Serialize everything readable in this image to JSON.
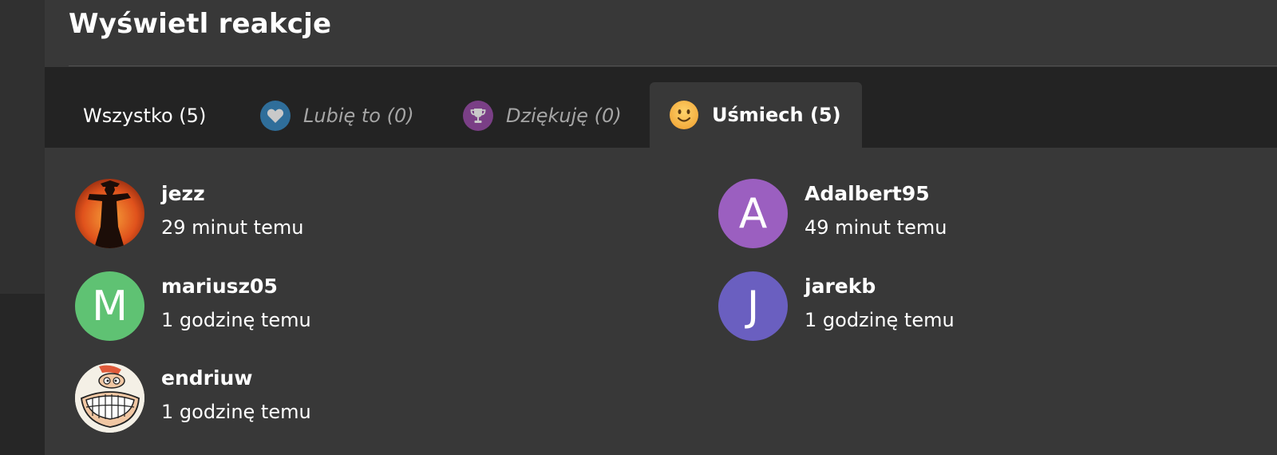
{
  "dialog": {
    "title": "Wyświetl reakcje"
  },
  "tabs": [
    {
      "label": "Wszystko (5)",
      "icon": null,
      "active": false
    },
    {
      "label": "Lubię to (0)",
      "icon": "heart-icon",
      "color": "#2f6e9a",
      "active": false
    },
    {
      "label": "Dziękuję (0)",
      "icon": "trophy-icon",
      "color": "#7a3f86",
      "active": false
    },
    {
      "label": "Uśmiech (5)",
      "icon": "smiley-icon",
      "color": "#f5b942",
      "active": true
    }
  ],
  "reactions": [
    {
      "name": "jezz",
      "time": "29 minut temu",
      "avatar_type": "image",
      "avatar_desc": "orange-scarecrow-silhouette"
    },
    {
      "name": "Adalbert95",
      "time": "49 minut temu",
      "avatar_type": "letter",
      "avatar_letter": "A",
      "avatar_color": "#9b5fc0"
    },
    {
      "name": "mariusz05",
      "time": "1 godzinę temu",
      "avatar_type": "letter",
      "avatar_letter": "M",
      "avatar_color": "#5fc273"
    },
    {
      "name": "jarekb",
      "time": "1 godzinę temu",
      "avatar_type": "letter",
      "avatar_letter": "J",
      "avatar_color": "#6a5fc0"
    },
    {
      "name": "endriuw",
      "time": "1 godzinę temu",
      "avatar_type": "image",
      "avatar_desc": "cartoon-grinning-face"
    }
  ]
}
